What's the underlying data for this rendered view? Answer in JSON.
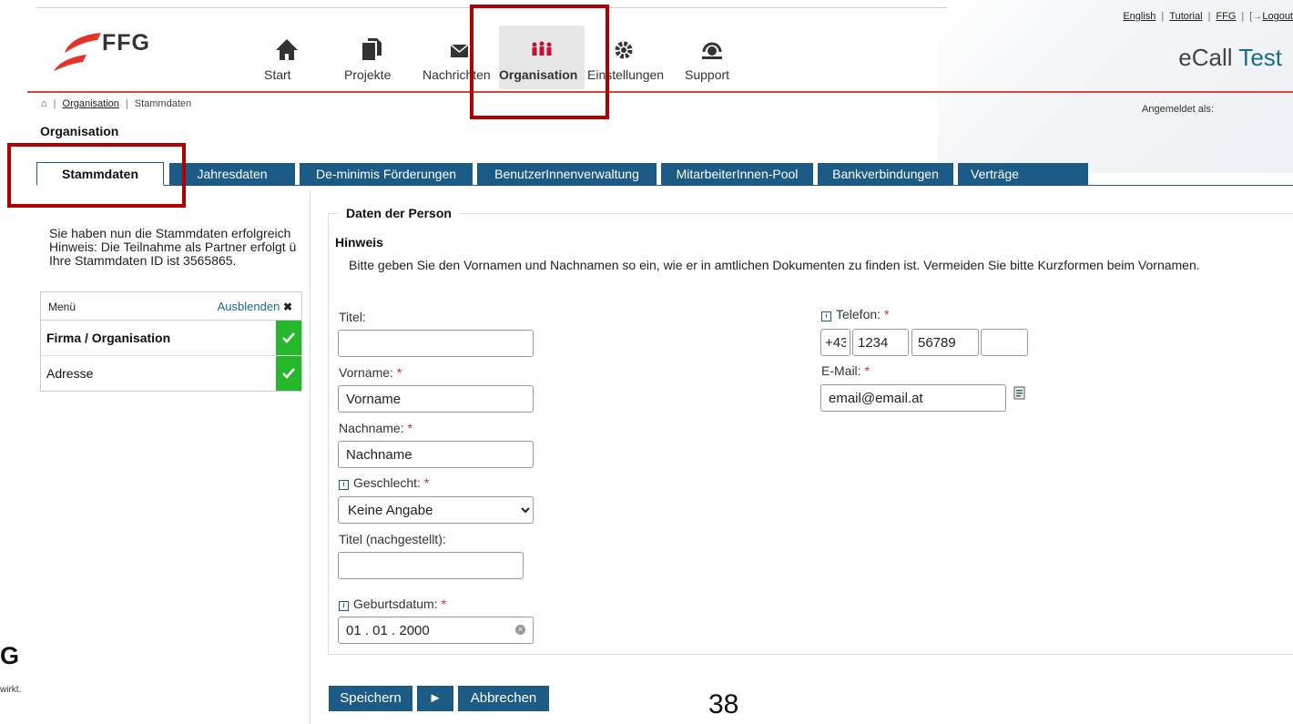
{
  "header": {
    "logo_text": "FFG",
    "nav": [
      {
        "label": "Start",
        "icon": "home-icon"
      },
      {
        "label": "Projekte",
        "icon": "documents-icon"
      },
      {
        "label": "Nachrichten",
        "icon": "envelope-icon"
      },
      {
        "label": "Organisation",
        "icon": "people-icon"
      },
      {
        "label": "Einstellungen",
        "icon": "gear-icon"
      },
      {
        "label": "Support",
        "icon": "headset-icon"
      }
    ],
    "top_links": [
      "English",
      "Tutorial",
      "FFG",
      "Logout"
    ],
    "app_title_prefix": "eCall",
    "app_title_suffix": "Test",
    "breadcrumb": [
      "Organisation",
      "Stammdaten"
    ],
    "logged_in": "Angemeldet als:",
    "page_title": "Organisation"
  },
  "tabs": [
    "Stammdaten",
    "Jahresdaten",
    "De-minimis Förderungen",
    "BenutzerInnenverwaltung",
    "MitarbeiterInnen-Pool",
    "Bankverbindungen",
    "Verträge"
  ],
  "sidebar": {
    "success_lines": [
      "Sie haben nun die Stammdaten erfolgreich",
      "Hinweis: Die Teilnahme als Partner erfolgt ü",
      "Ihre Stammdaten ID ist 3565865."
    ],
    "menu_title": "Menü",
    "menu_hide": "Ausblenden",
    "items": [
      "Firma / Organisation",
      "Adresse"
    ],
    "footer_logo": "G",
    "footer_text": "wirkt."
  },
  "form": {
    "legend": "Daten der Person",
    "hint_title": "Hinweis",
    "hint_text": "Bitte geben Sie den Vornamen und Nachnamen so ein, wie er in amtlichen Dokumenten zu finden ist. Vermeiden Sie bitte Kurzformen beim Vornamen.",
    "titel_label": "Titel:",
    "titel_value": "",
    "vorname_label": "Vorname:",
    "vorname_value": "Vorname",
    "nachname_label": "Nachname:",
    "nachname_value": "Nachname",
    "geschlecht_label": "Geschlecht:",
    "geschlecht_value": "Keine Angabe",
    "titel_nach_label": "Titel (nachgestellt):",
    "titel_nach_value": "",
    "geburtsdatum_label": "Geburtsdatum:",
    "geburtsdatum_value": "01 . 01 . 2000",
    "telefon_label": "Telefon:",
    "telefon_country": "+43",
    "telefon_area": "1234",
    "telefon_number": "56789",
    "telefon_ext": "",
    "email_label": "E-Mail:",
    "email_value": "email@email.at",
    "required_mark": "*"
  },
  "buttons": {
    "save": "Speichern",
    "next": "►",
    "cancel": "Abbrechen"
  },
  "page_number": "38",
  "colors": {
    "accent": "#1b5b86",
    "brand_red": "#e6332a",
    "highlight": "#b00000",
    "check": "#26b82b"
  }
}
